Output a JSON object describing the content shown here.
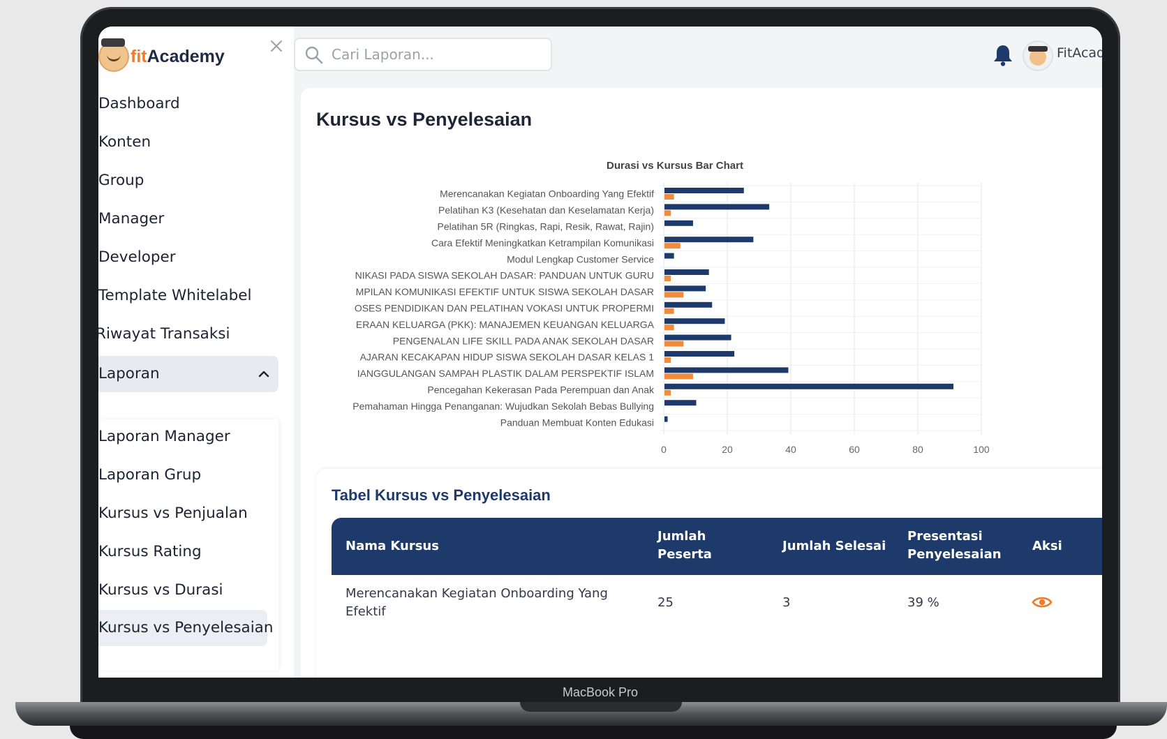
{
  "device": {
    "label": "MacBook Pro"
  },
  "brand": {
    "name_prefix": "fit",
    "name_suffix": "Academy"
  },
  "sidebar": {
    "items": [
      {
        "label": "Dashboard"
      },
      {
        "label": "Konten"
      },
      {
        "label": "Group"
      },
      {
        "label": "Manager"
      },
      {
        "label": "Developer"
      },
      {
        "label": "Template Whitelabel"
      },
      {
        "label": "Riwayat Transaksi"
      },
      {
        "label": "Laporan"
      }
    ],
    "submenu": [
      {
        "label": "Laporan Manager"
      },
      {
        "label": "Laporan Grup"
      },
      {
        "label": "Kursus vs Penjualan"
      },
      {
        "label": "Kursus Rating"
      },
      {
        "label": "Kursus vs Durasi"
      },
      {
        "label": "Kursus vs Penyelesaian"
      }
    ]
  },
  "topbar": {
    "search_placeholder": "Cari Laporan...",
    "user_name": "FitAcademy"
  },
  "page": {
    "title": "Kursus vs Penyelesaian"
  },
  "chart_data": {
    "type": "bar",
    "orientation": "horizontal",
    "title": "Durasi vs Kursus Bar Chart",
    "categories": [
      "Merencanakan Kegiatan Onboarding Yang Efektif",
      "Pelatihan K3 (Kesehatan dan Keselamatan Kerja)",
      "Pelatihan 5R (Ringkas, Rapi, Resik, Rawat, Rajin)",
      "Cara Efektif Meningkatkan Ketrampilan Komunikasi",
      "Modul Lengkap Customer Service",
      "NIKASI PADA SISWA SEKOLAH DASAR: PANDUAN UNTUK GURU",
      "MPILAN KOMUNIKASI EFEKTIF UNTUK SISWA SEKOLAH DASAR",
      "OSES PENDIDIKAN DAN PELATIHAN VOKASI UNTUK PROPERMI",
      "ERAAN KELUARGA (PKK): MANAJEMEN KEUANGAN KELUARGA",
      "PENGENALAN LIFE SKILL PADA ANAK SEKOLAH DASAR",
      "AJARAN KECAKAPAN HIDUP SISWA SEKOLAH DASAR KELAS 1",
      "IANGGULANGAN SAMPAH PLASTIK DALAM PERSPEKTIF ISLAM",
      "Pencegahan Kekerasan Pada Perempuan dan Anak",
      "Pemahaman Hingga Penanganan: Wujudkan Sekolah Bebas Bullying",
      "Panduan Membuat Konten Edukasi"
    ],
    "series": [
      {
        "name": "Jumlah Peserta",
        "color": "#1e3a6b",
        "values": [
          25,
          33,
          9,
          28,
          3,
          14,
          13,
          15,
          19,
          21,
          22,
          39,
          91,
          10,
          1
        ]
      },
      {
        "name": "Jumlah Selesai",
        "color": "#f08a3c",
        "values": [
          3,
          2,
          0,
          5,
          0,
          2,
          6,
          3,
          3,
          6,
          2,
          9,
          2,
          0,
          0
        ]
      }
    ],
    "xlim": [
      0,
      100
    ],
    "xticks": [
      "0",
      "20",
      "40",
      "60",
      "80",
      "100"
    ],
    "grid": true,
    "legend_position": "bottom"
  },
  "table": {
    "title": "Tabel Kursus vs Penyelesaian",
    "headers": {
      "nama_kursus": "Nama Kursus",
      "jumlah_peserta_1": "Jumlah",
      "jumlah_peserta_2": "Peserta",
      "jumlah_selesai": "Jumlah Selesai",
      "presentasi_1": "Presentasi",
      "presentasi_2": "Penyelesaian",
      "aksi": "Aksi"
    },
    "rows": [
      {
        "nama_1": "Merencanakan Kegiatan Onboarding Yang",
        "nama_2": "Efektif",
        "peserta": "25",
        "selesai": "3",
        "presentasi": "39 %"
      }
    ]
  },
  "colors": {
    "navy": "#1e3a6b",
    "orange": "#f08a3c",
    "accent": "#f07b2a"
  }
}
